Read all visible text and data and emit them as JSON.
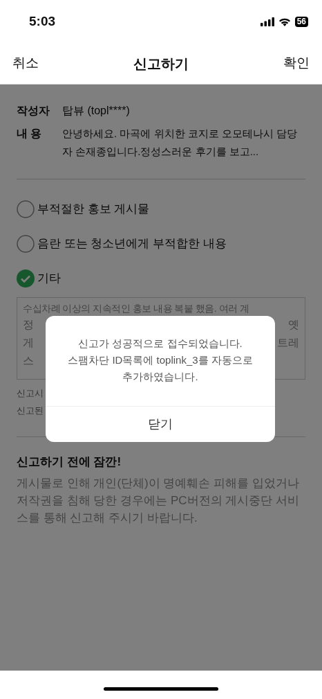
{
  "status_bar": {
    "time": "5:03",
    "battery": "56"
  },
  "nav": {
    "cancel": "취소",
    "title": "신고하기",
    "confirm": "확인"
  },
  "post": {
    "author_label": "작성자",
    "author": "탑뷰 (topl****)",
    "content_label": "내 용",
    "content": "안녕하세요. 마곡에 위치한 코지로 오모테나시 담당자 손재종입니다.정성스러운 후기를 보고..."
  },
  "reasons": [
    {
      "label": "부적절한 홍보 게시물",
      "selected": false
    },
    {
      "label": "음란 또는 청소년에게 부적합한 내용",
      "selected": false
    },
    {
      "label": "기타",
      "selected": true
    }
  ],
  "reason_text": {
    "first_line": "수십차례 이상의 지속적인 홍보 내용 복붙 했음. 여러 계",
    "left_parts": [
      "정",
      "게",
      "스"
    ],
    "right_parts": [
      "옛",
      "트레"
    ]
  },
  "notes": [
    "신고시",
    "신고된"
  ],
  "notice": {
    "title": "신고하기 전에 잠깐!",
    "body": "게시물로 인해 개인(단체)이 명예훼손 피해를 입었거나 저작권을 침해 당한 경우에는 PC버전의 게시중단 서비스를 통해 신고해 주시기 바랍니다."
  },
  "dialog": {
    "message": [
      "신고가 성공적으로 접수되었습니다.",
      "스팸차단 ID목록에 toplink_3를 자동으로",
      "추가하였습니다."
    ],
    "button": "닫기"
  }
}
